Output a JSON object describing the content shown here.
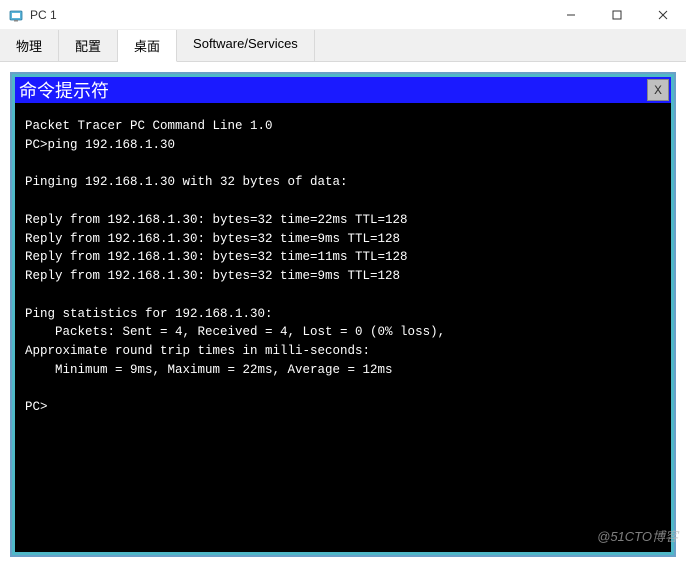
{
  "window": {
    "title": "PC 1",
    "controls": {
      "minimize": "minimize",
      "maximize": "maximize",
      "close": "close"
    }
  },
  "tabs": [
    {
      "label": "物理",
      "active": false
    },
    {
      "label": "配置",
      "active": false
    },
    {
      "label": "桌面",
      "active": true
    },
    {
      "label": "Software/Services",
      "active": false
    }
  ],
  "terminal": {
    "title": "命令提示符",
    "close_label": "X",
    "lines": [
      "Packet Tracer PC Command Line 1.0",
      "PC>ping 192.168.1.30",
      "",
      "Pinging 192.168.1.30 with 32 bytes of data:",
      "",
      "Reply from 192.168.1.30: bytes=32 time=22ms TTL=128",
      "Reply from 192.168.1.30: bytes=32 time=9ms TTL=128",
      "Reply from 192.168.1.30: bytes=32 time=11ms TTL=128",
      "Reply from 192.168.1.30: bytes=32 time=9ms TTL=128",
      "",
      "Ping statistics for 192.168.1.30:",
      "    Packets: Sent = 4, Received = 4, Lost = 0 (0% loss),",
      "Approximate round trip times in milli-seconds:",
      "    Minimum = 9ms, Maximum = 22ms, Average = 12ms",
      "",
      "PC>"
    ]
  },
  "watermark": "@51CTO博客"
}
